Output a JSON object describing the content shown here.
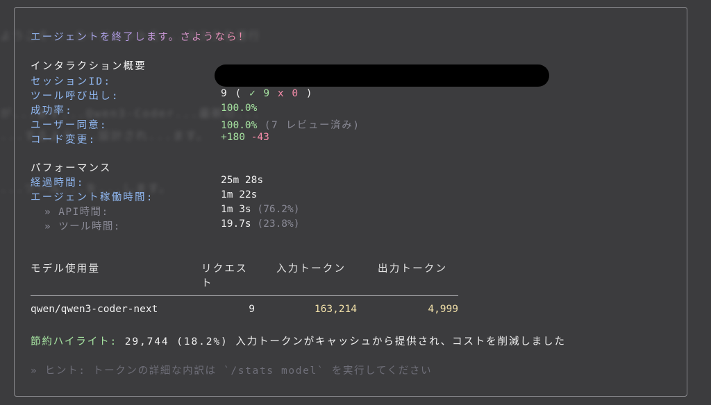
{
  "farewell": "エージェントを終了します。さようなら！",
  "summary": {
    "heading": "インタラクション概要",
    "session_label": "セッションID:",
    "tool_calls_label": "ツール呼び出し:",
    "tool_calls_total": "9",
    "tool_calls_open": " ( ",
    "tool_calls_success": "✓ 9",
    "tool_calls_fail": "x 0",
    "tool_calls_close": " )",
    "success_rate_label": "成功率:",
    "success_rate_value": "100.0%",
    "user_consent_label": "ユーザー同意:",
    "user_consent_value": "100.0%",
    "user_consent_note": " (7 レビュー済み)",
    "code_changes_label": "コード変更:",
    "code_added": "+180",
    "code_removed": "-43"
  },
  "performance": {
    "heading": "パフォーマンス",
    "elapsed_label": "経過時間:",
    "elapsed_value": "25m 28s",
    "agent_active_label": "エージェント稼働時間:",
    "agent_active_value": "1m 22s",
    "api_label": "» API時間:",
    "api_value": "1m 3s",
    "api_pct": " (76.2%)",
    "tool_label": "» ツール時間:",
    "tool_value": "19.7s",
    "tool_pct": " (23.8%)"
  },
  "model_table": {
    "headers": [
      "モデル使用量",
      "リクエス",
      "ト",
      "入力トークン",
      "出力トークン"
    ],
    "rows": [
      {
        "model": "qwen/qwen3-coder-next",
        "requests": "9",
        "input_tokens": "163,214",
        "output_tokens": "4,999"
      }
    ]
  },
  "savings": {
    "label": "節約ハイライト:",
    "text": " 29,744 (18.2%) 入力トークンがキャッシュから提供され、コストを削減しました"
  },
  "tip": "» ヒント: トークンの詳細な内訳は `/stats model` を実行してください",
  "background_text": [
    "ようこそ...エージェントを...タスクを遂行",
    "が...ます...Qwen3-Coder...最新の...",
    "...するよう...設計され...ます。",
    "...ツール...を...します。"
  ],
  "colors": {
    "background": "#3c3c3e",
    "label_blue": "#8fb6ef",
    "heading_purple": "#b89ae6",
    "success_green": "#a6e3a1",
    "fail_red": "#f38ba8",
    "token_yellow": "#f0dfa8",
    "dim_gray": "#8a8a96"
  }
}
